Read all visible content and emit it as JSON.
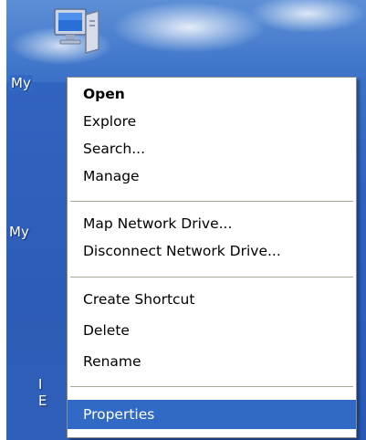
{
  "desktop": {
    "icons": [
      {
        "label": "My",
        "selected": true
      },
      {
        "label": "My",
        "selected": false
      },
      {
        "label": "I",
        "selected": false
      },
      {
        "label": "E",
        "selected": false
      }
    ]
  },
  "context_menu": {
    "groups": [
      [
        {
          "label": "Open",
          "bold": true
        },
        {
          "label": "Explore"
        },
        {
          "label": "Search..."
        },
        {
          "label": "Manage"
        }
      ],
      [
        {
          "label": "Map Network Drive..."
        },
        {
          "label": "Disconnect Network Drive..."
        }
      ],
      [
        {
          "label": "Create Shortcut"
        },
        {
          "label": "Delete"
        },
        {
          "label": "Rename"
        }
      ],
      [
        {
          "label": "Properties",
          "highlighted": true
        }
      ]
    ]
  },
  "colors": {
    "selection": "#316ac5",
    "menu_bg": "#ffffff",
    "separator": "#aca899",
    "desktop": "#2e62bf"
  },
  "icons": {
    "computer": "my-computer-icon"
  }
}
